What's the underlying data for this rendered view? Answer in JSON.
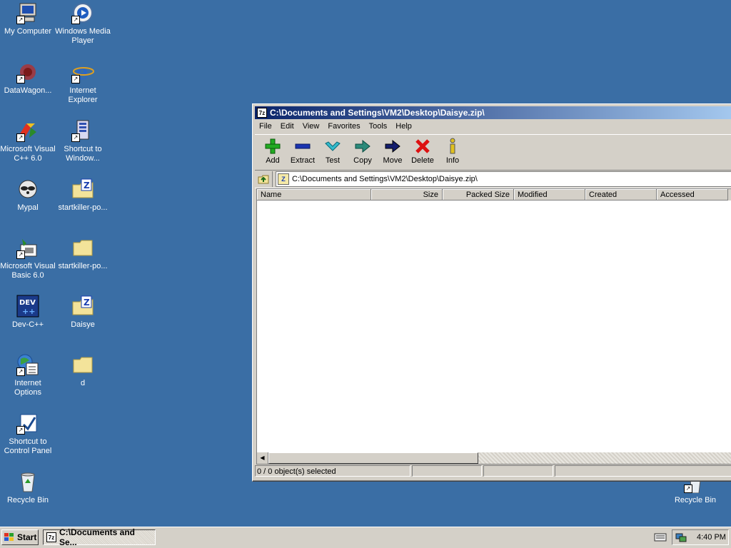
{
  "desktop": {
    "icons": [
      {
        "label": "My Computer"
      },
      {
        "label": "Windows Media Player"
      },
      {
        "label": "DataWagon..."
      },
      {
        "label": "Internet Explorer"
      },
      {
        "label": "Microsoft Visual C++ 6.0"
      },
      {
        "label": "Shortcut to Window..."
      },
      {
        "label": "Mypal"
      },
      {
        "label": "startkiller-po..."
      },
      {
        "label": "Microsoft Visual Basic 6.0"
      },
      {
        "label": "startkiller-po..."
      },
      {
        "label": "Dev-C++"
      },
      {
        "label": "Daisye"
      },
      {
        "label": "Internet Options"
      },
      {
        "label": "d"
      },
      {
        "label": "Shortcut to Control Panel"
      },
      {
        "label": "Recycle Bin"
      },
      {
        "label": "Recycle Bin"
      }
    ]
  },
  "window": {
    "title": "C:\\Documents and Settings\\VM2\\Desktop\\Daisye.zip\\",
    "title_icon": "7z",
    "menu": [
      "File",
      "Edit",
      "View",
      "Favorites",
      "Tools",
      "Help"
    ],
    "toolbar": [
      {
        "label": "Add",
        "icon": "plus-icon",
        "color": "#22aa22"
      },
      {
        "label": "Extract",
        "icon": "minus-icon",
        "color": "#1a33b0"
      },
      {
        "label": "Test",
        "icon": "check-icon",
        "color": "#33bbcc"
      },
      {
        "label": "Copy",
        "icon": "copy-arrow-icon",
        "color": "#2a8a7a"
      },
      {
        "label": "Move",
        "icon": "move-arrow-icon",
        "color": "#141e6e"
      },
      {
        "label": "Delete",
        "icon": "x-icon",
        "color": "#dd1111"
      },
      {
        "label": "Info",
        "icon": "info-icon",
        "color": "#c9a000"
      }
    ],
    "address": "C:\\Documents and Settings\\VM2\\Desktop\\Daisye.zip\\",
    "columns": [
      "Name",
      "Size",
      "Packed Size",
      "Modified",
      "Created",
      "Accessed"
    ],
    "status": "0 / 0 object(s) selected"
  },
  "taskbar": {
    "start_label": "Start",
    "task_label": "C:\\Documents and Se...",
    "task_icon": "7z",
    "clock": "4:40 PM"
  }
}
